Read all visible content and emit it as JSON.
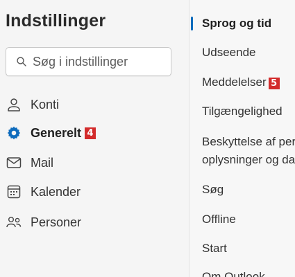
{
  "page_title": "Indstillinger",
  "search": {
    "placeholder": "Søg i indstillinger"
  },
  "nav": [
    {
      "label": "Konti",
      "icon": "person-icon",
      "active": false
    },
    {
      "label": "Generelt",
      "icon": "gear-icon",
      "active": true,
      "badge": "4"
    },
    {
      "label": "Mail",
      "icon": "mail-icon",
      "active": false
    },
    {
      "label": "Kalender",
      "icon": "calendar-icon",
      "active": false
    },
    {
      "label": "Personer",
      "icon": "people-icon",
      "active": false
    }
  ],
  "subnav": [
    {
      "label": "Sprog og tid",
      "active": true
    },
    {
      "label": "Udseende"
    },
    {
      "label": "Meddelelser",
      "badge": "5"
    },
    {
      "label": "Tilgængelighed"
    },
    {
      "label": "Beskyttelse af personlige oplysninger og data"
    },
    {
      "label": "Søg"
    },
    {
      "label": "Offline"
    },
    {
      "label": "Start"
    },
    {
      "label": "Om Outlook"
    }
  ],
  "colors": {
    "accent": "#0f6cbd",
    "badge": "#d32b2b"
  }
}
